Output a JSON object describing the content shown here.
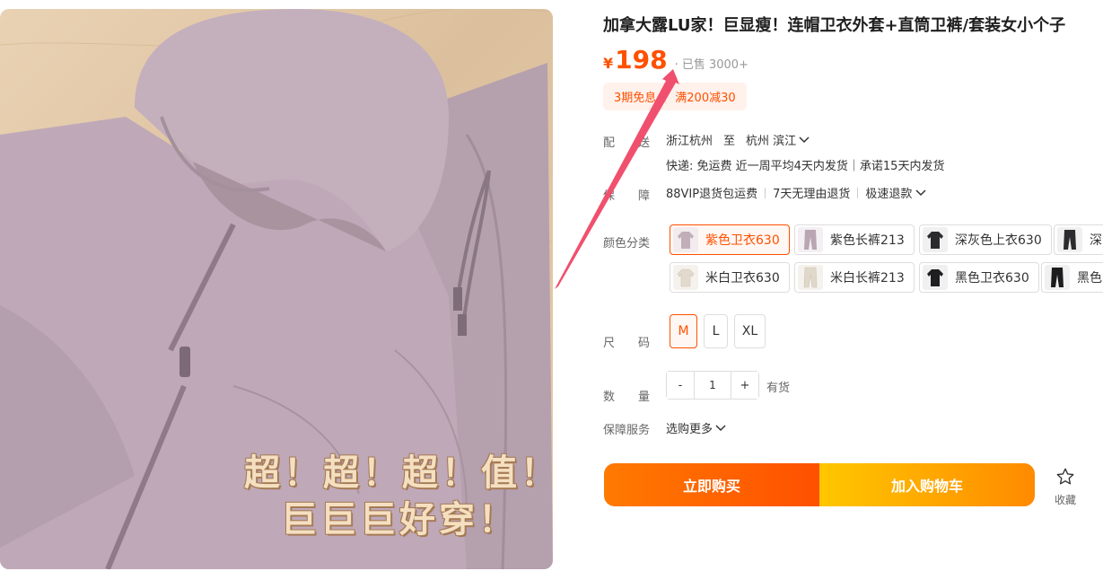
{
  "product": {
    "title": "加拿大露LU家！巨显瘦！连帽卫衣外套+直筒卫裤/套装女小个子",
    "price_symbol": "¥",
    "price": "198",
    "sold": "· 已售 3000+",
    "overlay_line1": "超！超！超！值！",
    "overlay_line2": "巨巨巨好穿！"
  },
  "promos": [
    "3期免息",
    "满200减30"
  ],
  "shipping": {
    "label": "配送",
    "from": "浙江杭州",
    "to_word": "至",
    "destination": "杭州 滨江",
    "detail": "快递: 免运费   近一周平均4天内发货｜承诺15天内发货"
  },
  "guarantee": {
    "label": "保障",
    "items": [
      "88VIP退货包运费",
      "7天无理由退货",
      "极速退款"
    ]
  },
  "colors": {
    "label": "颜色分类",
    "options": [
      {
        "label": "紫色卫衣630",
        "selected": true,
        "swatch": "#c2aeb8",
        "kind": "top"
      },
      {
        "label": "紫色长裤213",
        "selected": false,
        "swatch": "#b9a5b3",
        "kind": "pants"
      },
      {
        "label": "深灰色上衣630",
        "selected": false,
        "swatch": "#2b2b2e",
        "kind": "top"
      },
      {
        "label": "深",
        "selected": false,
        "swatch": "#2c2c2f",
        "kind": "pants"
      },
      {
        "label": "米白卫衣630",
        "selected": false,
        "swatch": "#ece6dc",
        "kind": "top"
      },
      {
        "label": "米白长裤213",
        "selected": false,
        "swatch": "#e8e1d4",
        "kind": "pants"
      },
      {
        "label": "黑色卫衣630",
        "selected": false,
        "swatch": "#1e1e20",
        "kind": "top"
      },
      {
        "label": "黑色",
        "selected": false,
        "swatch": "#1c1c1e",
        "kind": "pants"
      }
    ]
  },
  "sizes": {
    "label": "尺码",
    "options": [
      {
        "label": "M",
        "selected": true
      },
      {
        "label": "L",
        "selected": false
      },
      {
        "label": "XL",
        "selected": false
      }
    ]
  },
  "quantity": {
    "label": "数量",
    "minus": "-",
    "value": "1",
    "plus": "+",
    "stock": "有货"
  },
  "service": {
    "label": "保障服务",
    "value": "选购更多"
  },
  "actions": {
    "buy_now": "立即购买",
    "add_to_cart": "加入购物车",
    "favorite": "收藏"
  },
  "theme": {
    "accent": "#ff5000",
    "annotation_arrow": "#f0506e"
  }
}
